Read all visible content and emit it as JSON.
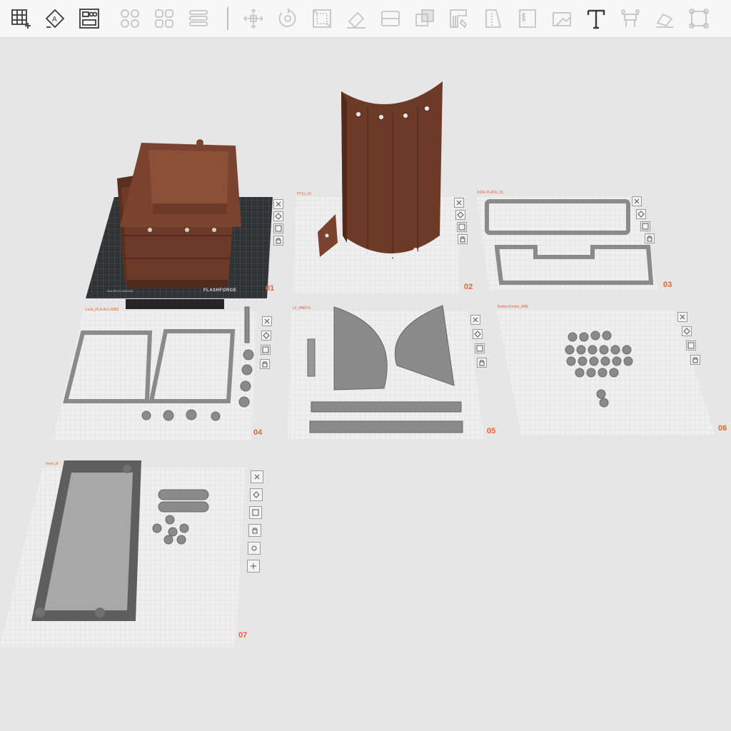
{
  "toolbar": {
    "buttons": [
      {
        "name": "add-plate-icon",
        "state": "active"
      },
      {
        "name": "auto-orient-icon",
        "state": "active"
      },
      {
        "name": "arrange-icon",
        "state": "active"
      },
      {
        "name": "split-objects-icon",
        "state": "disabled"
      },
      {
        "name": "split-parts-icon",
        "state": "disabled"
      },
      {
        "name": "layers-icon",
        "state": "disabled"
      },
      {
        "name": "move-icon",
        "state": "disabled"
      },
      {
        "name": "rotate-icon",
        "state": "disabled"
      },
      {
        "name": "scale-icon",
        "state": "disabled"
      },
      {
        "name": "lay-on-face-icon",
        "state": "disabled"
      },
      {
        "name": "cut-icon",
        "state": "disabled"
      },
      {
        "name": "boolean-icon",
        "state": "disabled"
      },
      {
        "name": "support-paint-icon",
        "state": "disabled"
      },
      {
        "name": "seam-paint-icon",
        "state": "disabled"
      },
      {
        "name": "fuzzy-skin-icon",
        "state": "disabled"
      },
      {
        "name": "measure-icon",
        "state": "disabled"
      },
      {
        "name": "text-icon",
        "state": "active"
      },
      {
        "name": "brim-ears-icon",
        "state": "disabled"
      },
      {
        "name": "assembly-icon",
        "state": "disabled"
      },
      {
        "name": "variable-height-icon",
        "state": "disabled"
      }
    ],
    "active_color": "#3a3a3a",
    "disabled_color": "#c4c4c4"
  },
  "plates": [
    {
      "number": "01",
      "name": "",
      "printer_brand": "FLASHFORGE",
      "bed_model": "SLA PETG 200X200",
      "type": "bed"
    },
    {
      "number": "02",
      "name": "PT10_01",
      "type": "grid"
    },
    {
      "number": "03",
      "name": "SIDE-PLATE_01",
      "type": "grid"
    },
    {
      "number": "04",
      "name": "Lock_PLA-ALL-WBS",
      "type": "grid"
    },
    {
      "number": "05",
      "name": "LF_PARTS",
      "type": "grid"
    },
    {
      "number": "06",
      "name": "Button-Knobs_ANE",
      "type": "grid"
    },
    {
      "number": "07",
      "name": "Inner_B",
      "type": "grid"
    }
  ],
  "colors": {
    "accent": "#e8622c",
    "part_brown": "#6e3a28",
    "part_gray": "#8a8a8a",
    "grid_bg": "#f0f0f0",
    "grid_line": "#d6d6d6",
    "bed_dark": "#2f3336",
    "background": "#e6e6e6"
  }
}
